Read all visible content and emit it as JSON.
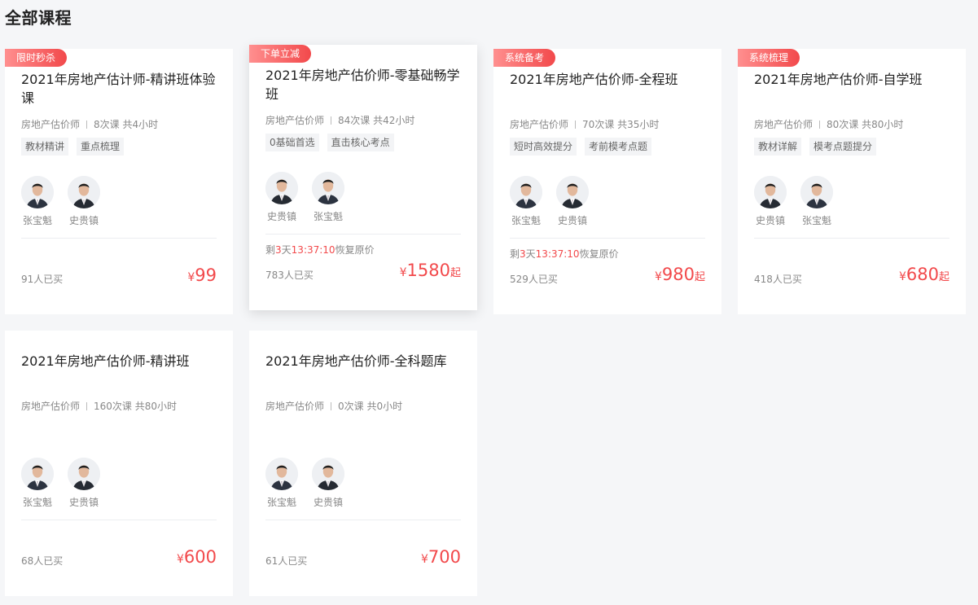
{
  "page": {
    "title": "全部课程"
  },
  "colors": {
    "accent": "#f2494b",
    "badge_from": "#ff8f8f",
    "badge_to": "#f2494b"
  },
  "cards": [
    {
      "badge": "限时秒杀",
      "title": "2021年房地产估计师-精讲班体验课",
      "subject": "房地产估价师",
      "lessons": "8次课 共4小时",
      "tags": [
        "教材精讲",
        "重点梳理"
      ],
      "teachers": [
        "张宝魁",
        "史贵镇"
      ],
      "countdown": null,
      "buyers": "91人已买",
      "currency": "¥",
      "price": "99",
      "price_suffix": ""
    },
    {
      "badge": "下单立减",
      "title": "2021年房地产估价师-零基础畅学班",
      "subject": "房地产估价师",
      "lessons": "84次课 共42小时",
      "tags": [
        "0基础首选",
        "直击核心考点"
      ],
      "teachers": [
        "史贵镇",
        "张宝魁"
      ],
      "countdown": {
        "prefix": "剩",
        "days": "3",
        "day_unit": "天",
        "time": "13:37:10",
        "suffix": "恢复原价"
      },
      "buyers": "783人已买",
      "currency": "¥",
      "price": "1580",
      "price_suffix": "起"
    },
    {
      "badge": "系统备考",
      "title": "2021年房地产估价师-全程班",
      "subject": "房地产估价师",
      "lessons": "70次课 共35小时",
      "tags": [
        "短时高效提分",
        "考前模考点题"
      ],
      "teachers": [
        "张宝魁",
        "史贵镇"
      ],
      "countdown": {
        "prefix": "剩",
        "days": "3",
        "day_unit": "天",
        "time": "13:37:10",
        "suffix": "恢复原价"
      },
      "buyers": "529人已买",
      "currency": "¥",
      "price": "980",
      "price_suffix": "起"
    },
    {
      "badge": "系统梳理",
      "title": "2021年房地产估价师-自学班",
      "subject": "房地产估价师",
      "lessons": "80次课 共80小时",
      "tags": [
        "教材详解",
        "模考点题提分"
      ],
      "teachers": [
        "史贵镇",
        "张宝魁"
      ],
      "countdown": null,
      "buyers": "418人已买",
      "currency": "¥",
      "price": "680",
      "price_suffix": "起"
    },
    {
      "badge": null,
      "title": "2021年房地产估价师-精讲班",
      "subject": "房地产估价师",
      "lessons": "160次课 共80小时",
      "tags": [],
      "teachers": [
        "张宝魁",
        "史贵镇"
      ],
      "countdown": null,
      "buyers": "68人已买",
      "currency": "¥",
      "price": "600",
      "price_suffix": ""
    },
    {
      "badge": null,
      "title": "2021年房地产估价师-全科题库",
      "subject": "房地产估价师",
      "lessons": "0次课 共0小时",
      "tags": [],
      "teachers": [
        "张宝魁",
        "史贵镇"
      ],
      "countdown": null,
      "buyers": "61人已买",
      "currency": "¥",
      "price": "700",
      "price_suffix": ""
    }
  ]
}
